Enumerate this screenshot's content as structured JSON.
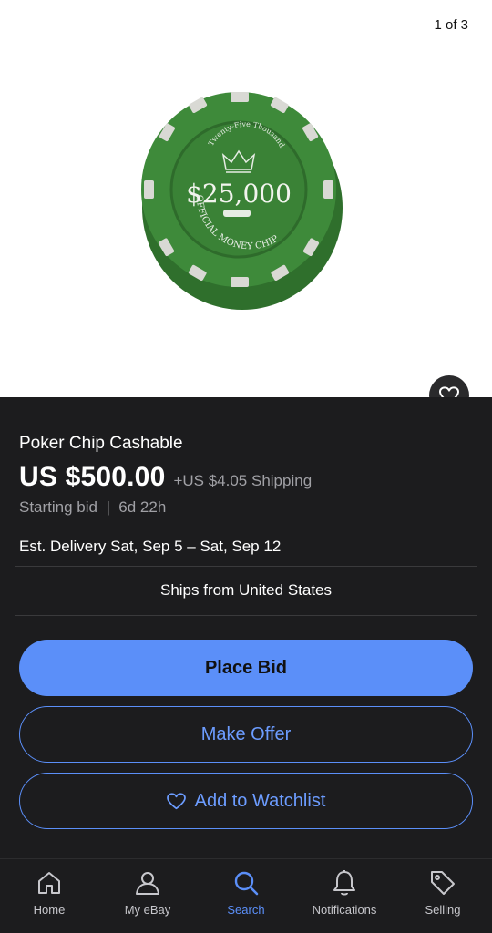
{
  "gallery": {
    "counter": "1 of 3"
  },
  "chip_image": {
    "top_text": "Twenty-Five Thousand",
    "value_text": "$25,000",
    "bottom_text": "OFFICIAL MONEY CHIP"
  },
  "listing": {
    "title": "Poker Chip Cashable",
    "price": "US $500.00",
    "shipping": "+US $4.05 Shipping",
    "bid_meta": "Starting bid  |  6d 22h",
    "delivery_prefix": "Est. Delivery ",
    "delivery_dates": "Sat, Sep 5 – Sat, Sep 12",
    "ships_from": "Ships from United States"
  },
  "actions": {
    "place_bid": "Place Bid",
    "make_offer": "Make Offer",
    "add_watchlist": "Add to Watchlist"
  },
  "tabbar": {
    "home": "Home",
    "my_ebay": "My eBay",
    "search": "Search",
    "notifications": "Notifications",
    "selling": "Selling",
    "active_tab": "search"
  },
  "colors": {
    "accent": "#5b8ff9",
    "background": "#1c1c1e",
    "chip_green": "#3e8a3a"
  }
}
